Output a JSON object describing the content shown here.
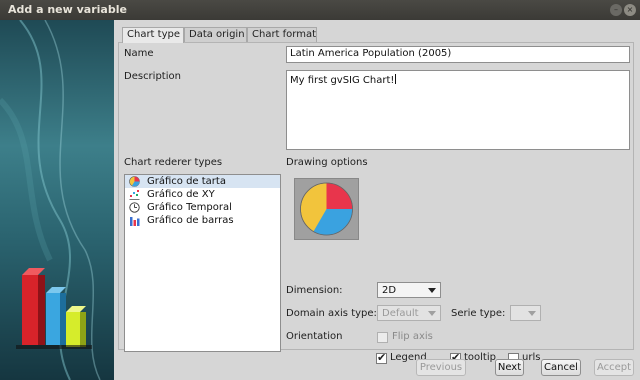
{
  "window": {
    "title": "Add a new variable"
  },
  "tabs": [
    {
      "label": "Chart type",
      "active": true
    },
    {
      "label": "Data origin",
      "active": false
    },
    {
      "label": "Chart format",
      "active": false
    }
  ],
  "form": {
    "name_label": "Name",
    "name_value": "Latin America Population (2005)",
    "description_label": "Description",
    "description_value": "My first gvSIG Chart!"
  },
  "renderer": {
    "label": "Chart rederer types",
    "items": [
      {
        "label": "Gráfico de tarta",
        "icon": "pie-chart-icon",
        "selected": true
      },
      {
        "label": "Gráfico de XY",
        "icon": "scatter-chart-icon",
        "selected": false
      },
      {
        "label": "Gráfico Temporal",
        "icon": "clock-icon",
        "selected": false
      },
      {
        "label": "Gráfico de barras",
        "icon": "bar-chart-icon",
        "selected": false
      }
    ]
  },
  "drawing": {
    "label": "Drawing options",
    "dimension_label": "Dimension:",
    "dimension_value": "2D",
    "domain_axis_label": "Domain axis type:",
    "domain_axis_value": "Default",
    "serie_type_label": "Serie type:",
    "serie_type_value": "",
    "orientation_label": "Orientation",
    "flip_axis_label": "Flip axis",
    "flip_axis_checked": false,
    "legend_label": "Legend",
    "legend_checked": true,
    "tooltip_label": "tooltip",
    "tooltip_checked": true,
    "urls_label": "urls",
    "urls_checked": false
  },
  "buttons": {
    "previous": "Previous",
    "next": "Next",
    "cancel": "Cancel",
    "accept": "Accept"
  },
  "colors": {
    "pie_red": "#e8354c",
    "pie_blue": "#3aa2e0",
    "pie_yellow": "#f2c43c"
  }
}
